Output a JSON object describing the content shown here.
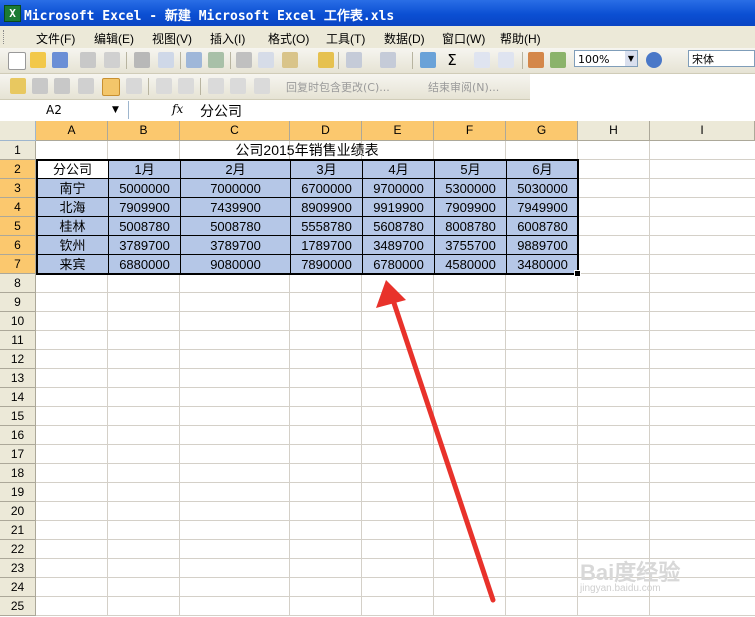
{
  "window": {
    "title": "Microsoft Excel - 新建 Microsoft Excel 工作表.xls",
    "icon": "excel-app-icon"
  },
  "menu": [
    "文件(F)",
    "编辑(E)",
    "视图(V)",
    "插入(I)",
    "格式(O)",
    "工具(T)",
    "数据(D)",
    "窗口(W)",
    "帮助(H)"
  ],
  "toolbar": {
    "zoom": "100%",
    "font": "宋体",
    "review_label": "回复时包含更改(C)...",
    "end_review_label": "结束审阅(N)..."
  },
  "formula": {
    "namebox": "A2",
    "fx": "fx",
    "value": "分公司"
  },
  "columns": [
    "A",
    "B",
    "C",
    "D",
    "E",
    "F",
    "G",
    "H",
    "I"
  ],
  "rows": [
    "1",
    "2",
    "3",
    "4",
    "5",
    "6",
    "7",
    "8",
    "9",
    "10",
    "11",
    "12",
    "13",
    "14",
    "15",
    "16",
    "17",
    "18",
    "19",
    "20",
    "21",
    "22",
    "23",
    "24",
    "25"
  ],
  "sheet": {
    "title": "公司2015年销售业绩表",
    "header": [
      "分公司",
      "1月",
      "2月",
      "3月",
      "4月",
      "5月",
      "6月"
    ],
    "data": [
      [
        "南宁",
        "5000000",
        "7000000",
        "6700000",
        "9700000",
        "5300000",
        "5030000"
      ],
      [
        "北海",
        "7909900",
        "7439900",
        "8909900",
        "9919900",
        "7909900",
        "7949900"
      ],
      [
        "桂林",
        "5008780",
        "5008780",
        "5558780",
        "5608780",
        "8008780",
        "6008780"
      ],
      [
        "钦州",
        "3789700",
        "3789700",
        "1789700",
        "3489700",
        "3755700",
        "9889700"
      ],
      [
        "来宾",
        "6880000",
        "9080000",
        "7890000",
        "6780000",
        "4580000",
        "3480000"
      ]
    ]
  },
  "watermark": {
    "text": "Bai度经验",
    "sub": "jingyan.baidu.com"
  },
  "colors": {
    "selection_fill": "#b5c7e7",
    "header_highlight": "#fbc86e",
    "arrow": "#e8322b"
  }
}
